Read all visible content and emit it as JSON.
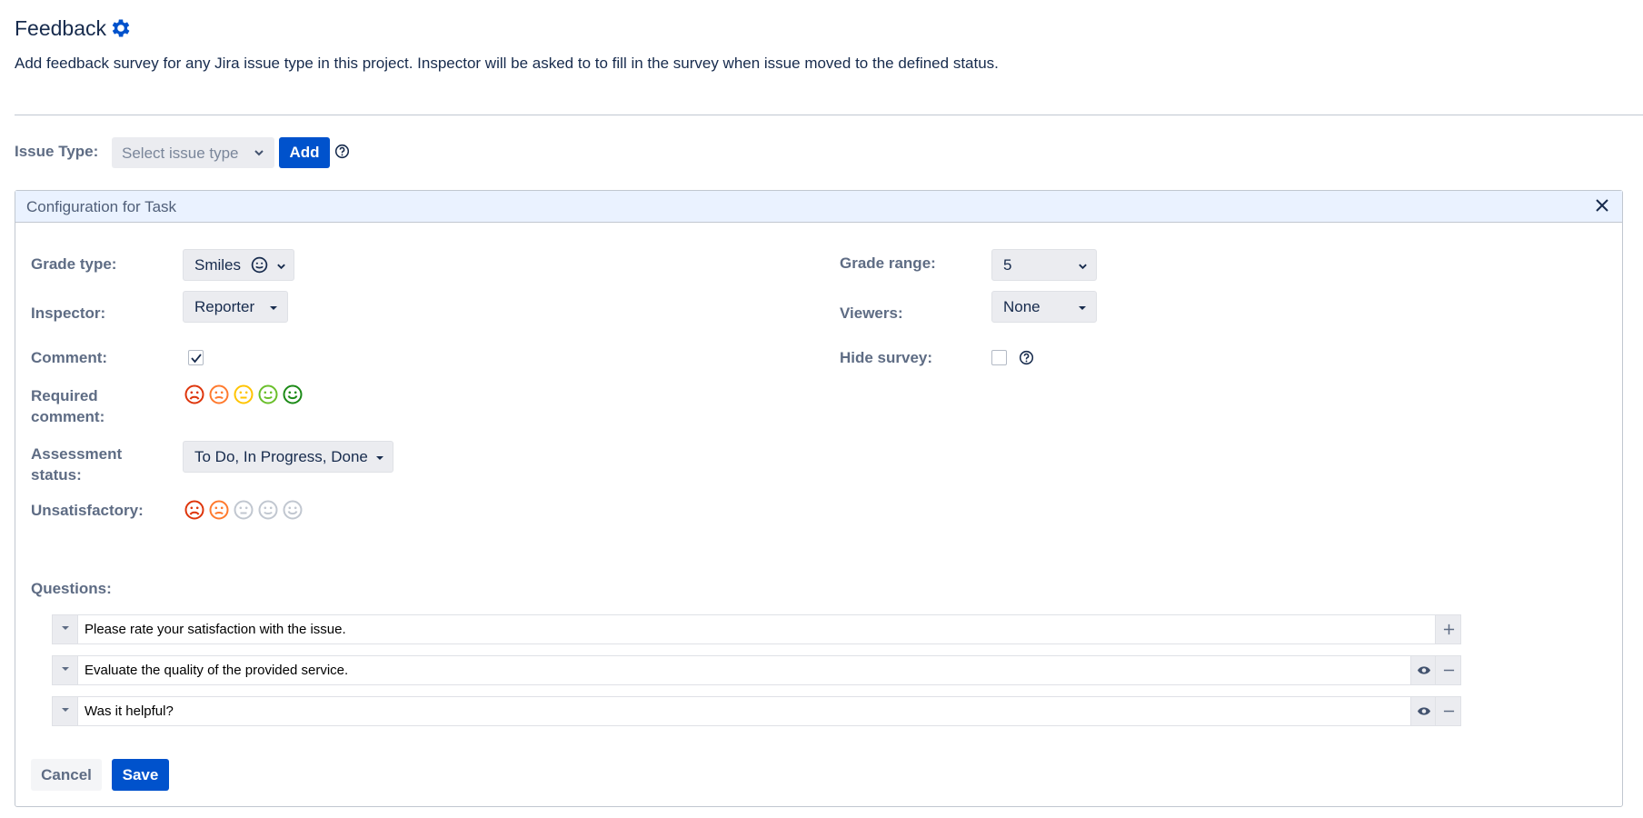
{
  "header": {
    "title": "Feedback",
    "description": "Add feedback survey for any Jira issue type in this project. Inspector will be asked to to fill in the survey when issue moved to the defined status."
  },
  "issue_type": {
    "label": "Issue Type:",
    "placeholder": "Select issue type",
    "add_label": "Add"
  },
  "panel": {
    "title": "Configuration for Task",
    "grade_type": {
      "label": "Grade type:",
      "value": "Smiles"
    },
    "grade_range": {
      "label": "Grade range:",
      "value": "5"
    },
    "inspector": {
      "label": "Inspector:",
      "value": "Reporter"
    },
    "viewers": {
      "label": "Viewers:",
      "value": "None"
    },
    "comment": {
      "label": "Comment:",
      "checked": true
    },
    "hide_survey": {
      "label": "Hide survey:",
      "checked": false
    },
    "required_comment": {
      "label_line1": "Required",
      "label_line2": "comment:",
      "active_count": 5
    },
    "assessment_status": {
      "label_line1": "Assessment",
      "label_line2": "status:",
      "value": "To Do, In Progress, Done"
    },
    "unsatisfactory": {
      "label": "Unsatisfactory:",
      "active_count": 2
    },
    "questions": {
      "label": "Questions:",
      "items": [
        "Please rate your satisfaction with the issue.",
        "Evaluate the quality of the provided service.",
        "Was it helpful?"
      ]
    },
    "cancel_label": "Cancel",
    "save_label": "Save"
  },
  "colors": {
    "primary": "#0052cc",
    "face_colors": [
      "#de350b",
      "#ff7a2e",
      "#ffc400",
      "#6abf2b",
      "#1b8a16"
    ],
    "face_inactive": "#c1c7d0"
  },
  "icons": [
    "gear-icon",
    "chevron-down-icon",
    "help-icon",
    "close-icon",
    "smile-icon",
    "eye-icon",
    "plus-icon",
    "minus-icon",
    "drag-handle-icon"
  ]
}
